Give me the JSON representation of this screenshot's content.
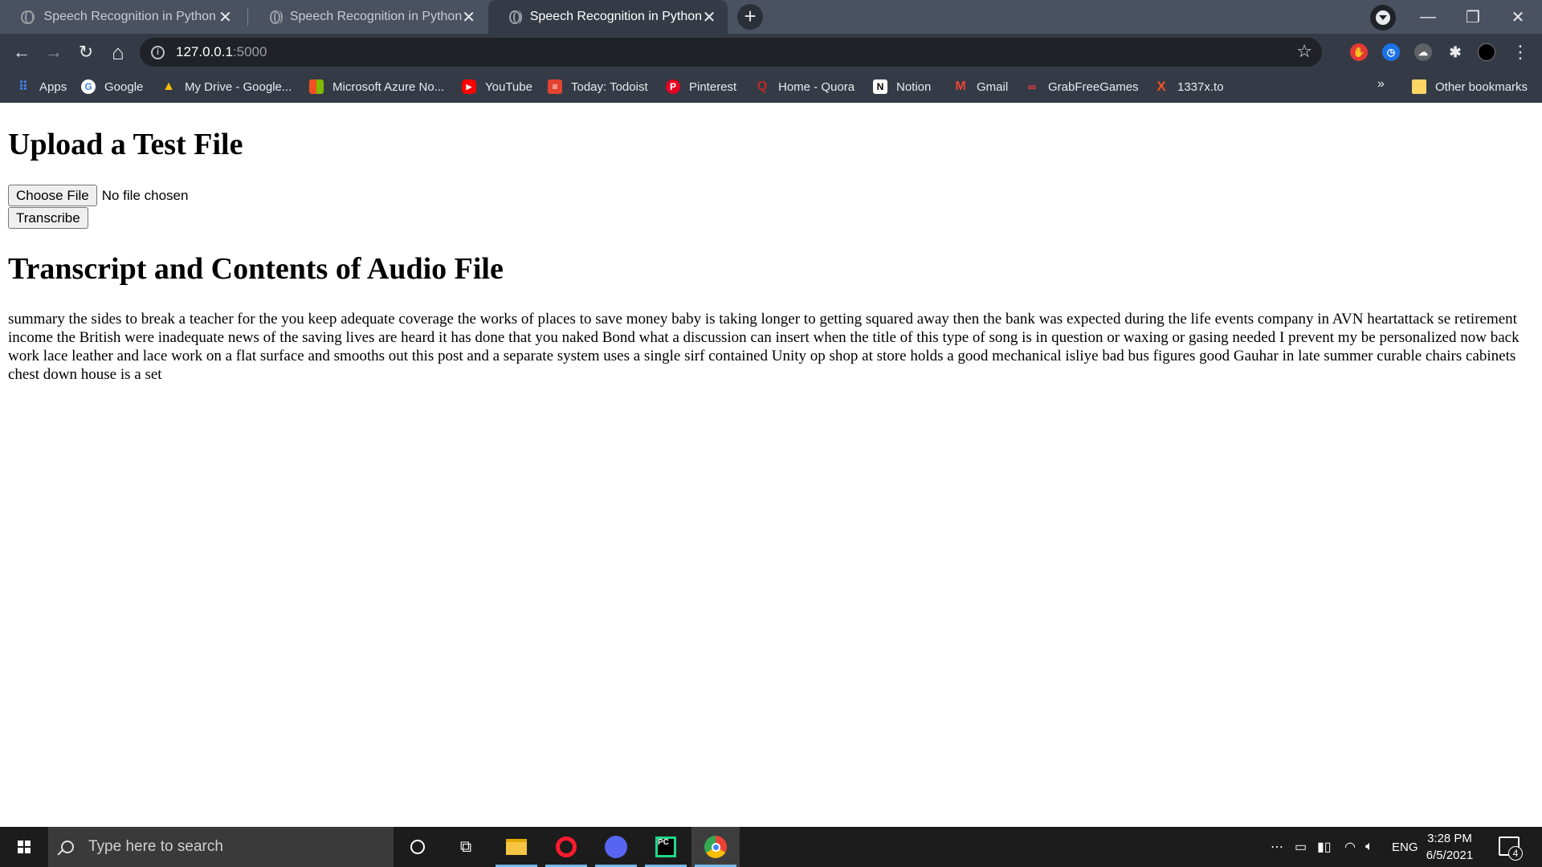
{
  "browser": {
    "tabs": [
      {
        "title": "Speech Recognition in Python",
        "close": "✕"
      },
      {
        "title": "Speech Recognition in Python",
        "close": "✕"
      },
      {
        "title": "Speech Recognition in Python",
        "close": "✕"
      }
    ],
    "new_tab": "+",
    "window": {
      "minimize": "—",
      "restore": "❐",
      "close": "✕"
    },
    "toolbar": {
      "back": "←",
      "forward": "→",
      "reload": "↻",
      "home": "⌂",
      "star": "☆",
      "menu": "⋮"
    },
    "address": {
      "host": "127.0.0.1",
      "port": ":5000"
    },
    "bookmarks": [
      {
        "label": "Apps",
        "icon": "apps-grid-icon",
        "color": "#4285f4"
      },
      {
        "label": "Google",
        "icon": "google-icon",
        "color": "#ffffff"
      },
      {
        "label": "My Drive - Google...",
        "icon": "drive-icon",
        "color": "#fbbc04"
      },
      {
        "label": "Microsoft Azure No...",
        "icon": "microsoft-icon",
        "color": "#f25022"
      },
      {
        "label": "YouTube",
        "icon": "youtube-icon",
        "color": "#ff0000"
      },
      {
        "label": "Today: Todoist",
        "icon": "todoist-icon",
        "color": "#e44332"
      },
      {
        "label": "Pinterest",
        "icon": "pinterest-icon",
        "color": "#e60023"
      },
      {
        "label": "Home - Quora",
        "icon": "quora-icon",
        "color": "#b92b27"
      },
      {
        "label": "Notion",
        "icon": "notion-icon",
        "color": "#ffffff"
      },
      {
        "label": "Gmail",
        "icon": "gmail-icon",
        "color": "#ea4335"
      },
      {
        "label": "GrabFreeGames",
        "icon": "grabfreegames-icon",
        "color": "#e53935"
      },
      {
        "label": "1337x.to",
        "icon": "x-icon",
        "color": "#f4511e"
      }
    ],
    "bookmarks_overflow": "»",
    "other_bookmarks": "Other bookmarks"
  },
  "page": {
    "upload_heading": "Upload a Test File",
    "choose_file_label": "Choose File",
    "file_status": "No file chosen",
    "transcribe_label": "Transcribe",
    "transcript_heading": "Transcript and Contents of Audio File",
    "transcript_text": "summary the sides to break a teacher for the you keep adequate coverage the works of places to save money baby is taking longer to getting squared away then the bank was expected during the life events company in AVN heartattack se retirement income the British were inadequate news of the saving lives are heard it has done that you naked Bond what a discussion can insert when the title of this type of song is in question or waxing or gasing needed I prevent my be personalized now back work lace leather and lace work on a flat surface and smooths out this post and a separate system uses a single sirf contained Unity op shop at store holds a good mechanical isliye bad bus figures good Gauhar in late summer curable chairs cabinets chest down house is a set"
  },
  "taskbar": {
    "search_placeholder": "Type here to search",
    "tray_overflow": "⋯",
    "language": "ENG",
    "time": "3:28 PM",
    "date": "6/5/2021",
    "notification_count": "4"
  },
  "colors": {
    "tab_strip": "#4a5160",
    "toolbar": "#353b46",
    "omnibox": "#202228",
    "taskbar": "#1c1c1c",
    "taskbar_search": "#3a3a3a"
  }
}
